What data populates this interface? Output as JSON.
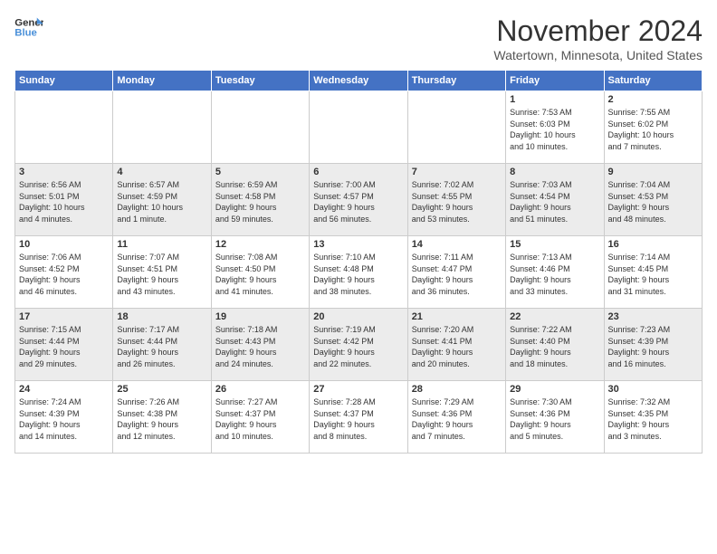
{
  "header": {
    "logo_line1": "General",
    "logo_line2": "Blue",
    "month": "November 2024",
    "location": "Watertown, Minnesota, United States"
  },
  "weekdays": [
    "Sunday",
    "Monday",
    "Tuesday",
    "Wednesday",
    "Thursday",
    "Friday",
    "Saturday"
  ],
  "weeks": [
    [
      {
        "day": "",
        "info": ""
      },
      {
        "day": "",
        "info": ""
      },
      {
        "day": "",
        "info": ""
      },
      {
        "day": "",
        "info": ""
      },
      {
        "day": "",
        "info": ""
      },
      {
        "day": "1",
        "info": "Sunrise: 7:53 AM\nSunset: 6:03 PM\nDaylight: 10 hours\nand 10 minutes."
      },
      {
        "day": "2",
        "info": "Sunrise: 7:55 AM\nSunset: 6:02 PM\nDaylight: 10 hours\nand 7 minutes."
      }
    ],
    [
      {
        "day": "3",
        "info": "Sunrise: 6:56 AM\nSunset: 5:01 PM\nDaylight: 10 hours\nand 4 minutes."
      },
      {
        "day": "4",
        "info": "Sunrise: 6:57 AM\nSunset: 4:59 PM\nDaylight: 10 hours\nand 1 minute."
      },
      {
        "day": "5",
        "info": "Sunrise: 6:59 AM\nSunset: 4:58 PM\nDaylight: 9 hours\nand 59 minutes."
      },
      {
        "day": "6",
        "info": "Sunrise: 7:00 AM\nSunset: 4:57 PM\nDaylight: 9 hours\nand 56 minutes."
      },
      {
        "day": "7",
        "info": "Sunrise: 7:02 AM\nSunset: 4:55 PM\nDaylight: 9 hours\nand 53 minutes."
      },
      {
        "day": "8",
        "info": "Sunrise: 7:03 AM\nSunset: 4:54 PM\nDaylight: 9 hours\nand 51 minutes."
      },
      {
        "day": "9",
        "info": "Sunrise: 7:04 AM\nSunset: 4:53 PM\nDaylight: 9 hours\nand 48 minutes."
      }
    ],
    [
      {
        "day": "10",
        "info": "Sunrise: 7:06 AM\nSunset: 4:52 PM\nDaylight: 9 hours\nand 46 minutes."
      },
      {
        "day": "11",
        "info": "Sunrise: 7:07 AM\nSunset: 4:51 PM\nDaylight: 9 hours\nand 43 minutes."
      },
      {
        "day": "12",
        "info": "Sunrise: 7:08 AM\nSunset: 4:50 PM\nDaylight: 9 hours\nand 41 minutes."
      },
      {
        "day": "13",
        "info": "Sunrise: 7:10 AM\nSunset: 4:48 PM\nDaylight: 9 hours\nand 38 minutes."
      },
      {
        "day": "14",
        "info": "Sunrise: 7:11 AM\nSunset: 4:47 PM\nDaylight: 9 hours\nand 36 minutes."
      },
      {
        "day": "15",
        "info": "Sunrise: 7:13 AM\nSunset: 4:46 PM\nDaylight: 9 hours\nand 33 minutes."
      },
      {
        "day": "16",
        "info": "Sunrise: 7:14 AM\nSunset: 4:45 PM\nDaylight: 9 hours\nand 31 minutes."
      }
    ],
    [
      {
        "day": "17",
        "info": "Sunrise: 7:15 AM\nSunset: 4:44 PM\nDaylight: 9 hours\nand 29 minutes."
      },
      {
        "day": "18",
        "info": "Sunrise: 7:17 AM\nSunset: 4:44 PM\nDaylight: 9 hours\nand 26 minutes."
      },
      {
        "day": "19",
        "info": "Sunrise: 7:18 AM\nSunset: 4:43 PM\nDaylight: 9 hours\nand 24 minutes."
      },
      {
        "day": "20",
        "info": "Sunrise: 7:19 AM\nSunset: 4:42 PM\nDaylight: 9 hours\nand 22 minutes."
      },
      {
        "day": "21",
        "info": "Sunrise: 7:20 AM\nSunset: 4:41 PM\nDaylight: 9 hours\nand 20 minutes."
      },
      {
        "day": "22",
        "info": "Sunrise: 7:22 AM\nSunset: 4:40 PM\nDaylight: 9 hours\nand 18 minutes."
      },
      {
        "day": "23",
        "info": "Sunrise: 7:23 AM\nSunset: 4:39 PM\nDaylight: 9 hours\nand 16 minutes."
      }
    ],
    [
      {
        "day": "24",
        "info": "Sunrise: 7:24 AM\nSunset: 4:39 PM\nDaylight: 9 hours\nand 14 minutes."
      },
      {
        "day": "25",
        "info": "Sunrise: 7:26 AM\nSunset: 4:38 PM\nDaylight: 9 hours\nand 12 minutes."
      },
      {
        "day": "26",
        "info": "Sunrise: 7:27 AM\nSunset: 4:37 PM\nDaylight: 9 hours\nand 10 minutes."
      },
      {
        "day": "27",
        "info": "Sunrise: 7:28 AM\nSunset: 4:37 PM\nDaylight: 9 hours\nand 8 minutes."
      },
      {
        "day": "28",
        "info": "Sunrise: 7:29 AM\nSunset: 4:36 PM\nDaylight: 9 hours\nand 7 minutes."
      },
      {
        "day": "29",
        "info": "Sunrise: 7:30 AM\nSunset: 4:36 PM\nDaylight: 9 hours\nand 5 minutes."
      },
      {
        "day": "30",
        "info": "Sunrise: 7:32 AM\nSunset: 4:35 PM\nDaylight: 9 hours\nand 3 minutes."
      }
    ]
  ]
}
